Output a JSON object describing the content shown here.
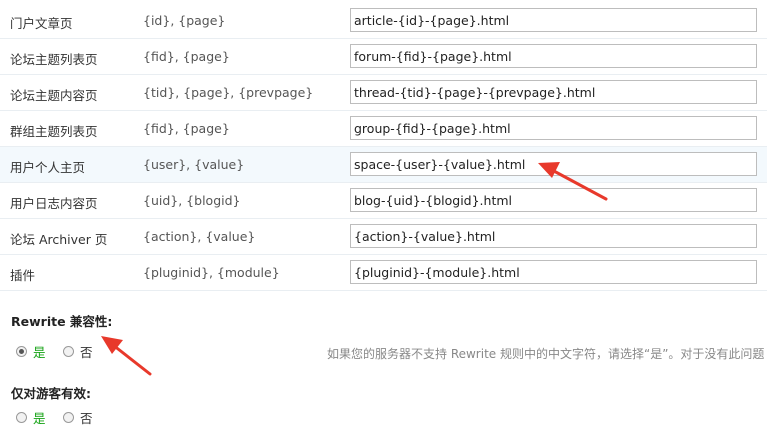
{
  "rows": [
    {
      "name": "门户文章页",
      "vars": "{id}, {page}",
      "value": "article-{id}-{page}.html"
    },
    {
      "name": "论坛主题列表页",
      "vars": "{fid}, {page}",
      "value": "forum-{fid}-{page}.html"
    },
    {
      "name": "论坛主题内容页",
      "vars": "{tid}, {page}, {prevpage}",
      "value": "thread-{tid}-{page}-{prevpage}.html"
    },
    {
      "name": "群组主题列表页",
      "vars": "{fid}, {page}",
      "value": "group-{fid}-{page}.html"
    },
    {
      "name": "用户个人主页",
      "vars": "{user}, {value}",
      "value": "space-{user}-{value}.html"
    },
    {
      "name": "用户日志内容页",
      "vars": "{uid}, {blogid}",
      "value": "blog-{uid}-{blogid}.html"
    },
    {
      "name": "论坛 Archiver 页",
      "vars": "{action}, {value}",
      "value": "{action}-{value}.html"
    },
    {
      "name": "插件",
      "vars": "{pluginid}, {module}",
      "value": "{pluginid}-{module}.html"
    }
  ],
  "rewrite_compat": {
    "title": "Rewrite 兼容性:",
    "yes_label": "是",
    "no_label": "否",
    "selected": "yes",
    "hint": "如果您的服务器不支持 Rewrite 规则中的中文字符，请选择“是”。对于没有此问题"
  },
  "guest_only": {
    "title": "仅对游客有效:",
    "yes_label": "是",
    "no_label": "否"
  },
  "colors": {
    "annotation_arrow": "#e8392b",
    "yes_text": "#16a316",
    "row_highlight": "#f3f9fd"
  }
}
